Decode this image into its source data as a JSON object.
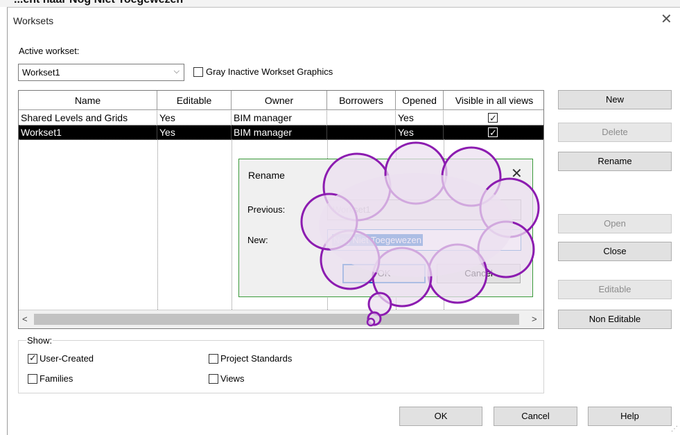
{
  "background_heading": "...ent naar Nog Niet Toegewezen",
  "window": {
    "title": "Worksets",
    "close": "✕"
  },
  "active_workset": {
    "label": "Active workset:",
    "value": "Workset1",
    "arrow": "⌵"
  },
  "gray_inactive": {
    "label": "Gray Inactive Workset Graphics",
    "checked": false
  },
  "table": {
    "columns": [
      "Name",
      "Editable",
      "Owner",
      "Borrowers",
      "Opened",
      "Visible in all views"
    ],
    "rows": [
      {
        "name": "Shared Levels and Grids",
        "editable": "Yes",
        "owner": "BIM manager",
        "borrowers": "",
        "opened": "Yes",
        "visible": true,
        "selected": false
      },
      {
        "name": "Workset1",
        "editable": "Yes",
        "owner": "BIM manager",
        "borrowers": "",
        "opened": "Yes",
        "visible": true,
        "selected": true
      }
    ],
    "scroll_left": "<",
    "scroll_right": ">"
  },
  "side_buttons": {
    "new": "New",
    "delete": "Delete",
    "rename": "Rename",
    "open": "Open",
    "close": "Close",
    "editable": "Editable",
    "non_editable": "Non Editable"
  },
  "show": {
    "label": "Show:",
    "user_created": {
      "label": "User-Created",
      "checked": true
    },
    "families": {
      "label": "Families",
      "checked": false
    },
    "project_standards": {
      "label": "Project Standards",
      "checked": false
    },
    "views": {
      "label": "Views",
      "checked": false
    }
  },
  "footer": {
    "ok": "OK",
    "cancel": "Cancel",
    "help": "Help"
  },
  "rename_dialog": {
    "title": "Rename",
    "close": "✕",
    "previous_label": "Previous:",
    "previous_value": "Workset1",
    "new_label": "New:",
    "new_value": "Nog Niet Toegewezen",
    "ok": "OK",
    "cancel": "Cancel"
  },
  "colors": {
    "selection": "#0a64c4",
    "cloud_fill": "#ebdff0",
    "cloud_stroke": "#8c1cb0",
    "rename_border": "#3a9a3a"
  }
}
